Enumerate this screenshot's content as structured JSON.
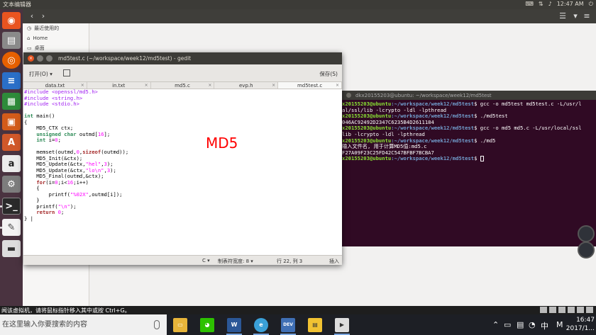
{
  "topbar": {
    "title": "文本编辑器",
    "time": "12:47 AM"
  },
  "files": {
    "side_items": [
      "最近使用的",
      "Home",
      "桌面"
    ]
  },
  "terminal": {
    "title": "dkx20155203@ubuntu: ~/workspace/week12/md5test",
    "lines": [
      {
        "user": "x20155203@ubuntu",
        "path": ":~/workspace/week12/md5test",
        "cmd": "$ gcc -o md5test md5test.c -L/usr/l"
      },
      {
        "user": "",
        "path": "",
        "cmd": "al/ssl/lib -lcrypto -ldl -lpthread"
      },
      {
        "user": "x20155203@ubuntu",
        "path": ":~/workspace/week12/md5test",
        "cmd": "$ ./md5test"
      },
      {
        "user": "",
        "path": "",
        "cmd": "046AC92492D2347C6235B4D2611184"
      },
      {
        "user": "x20155203@ubuntu",
        "path": ":~/workspace/week12/md5test",
        "cmd": "$ gcc -o md5 md5.c -L/usr/local/ssl"
      },
      {
        "user": "",
        "path": "",
        "cmd": "lib -lcrypto -ldl -lpthread"
      },
      {
        "user": "x20155203@ubuntu",
        "path": ":~/workspace/week12/md5test",
        "cmd": "$ ./md5"
      },
      {
        "user": "",
        "path": "",
        "cmd": "输入文件名, 用于计算MD5值:md5.c"
      },
      {
        "user": "",
        "path": "",
        "cmd": "F27A09F23C25FD42C547BFBF7BCBA7"
      },
      {
        "user": "x20155203@ubuntu",
        "path": ":~/workspace/week12/md5test",
        "cmd": "$ "
      }
    ]
  },
  "gedit": {
    "title": "md5test.c (~/workspace/week12/md5test) - gedit",
    "open_label": "打开(O) ▾",
    "save_label": "保存(S)",
    "tabs": [
      "data.txt",
      "in.txt",
      "md5.c",
      "evp.h",
      "md5test.c"
    ],
    "annotation": "MD5",
    "status": {
      "language": "C ▾",
      "tab_width": "制表符宽度: 8 ▾",
      "position": "行 22, 列 3",
      "mode": "插入"
    }
  },
  "vmbar": {
    "message": "闻该虚拟机，请将鼠标指针移入其中或按 Ctrl+G。"
  },
  "taskbar": {
    "search_placeholder": "在这里输入你要搜索的内容",
    "apps": [
      "files",
      "wechat",
      "word",
      "browser",
      "devcpp",
      "sticky",
      "player"
    ],
    "tray_lang": "中",
    "tray_ime": "M",
    "time": "16:47",
    "date": "2017/1..."
  }
}
